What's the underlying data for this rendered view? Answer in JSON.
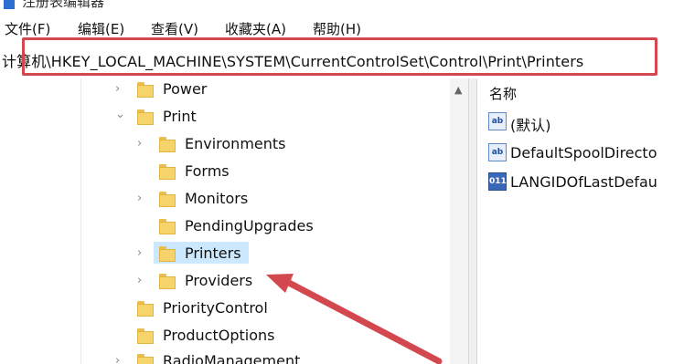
{
  "window": {
    "title": "注册表编辑器"
  },
  "menu": [
    {
      "label": "文件(F)"
    },
    {
      "label": "编辑(E)"
    },
    {
      "label": "查看(V)"
    },
    {
      "label": "收藏夹(A)"
    },
    {
      "label": "帮助(H)"
    }
  ],
  "address": {
    "path": "计算机\\HKEY_LOCAL_MACHINE\\SYSTEM\\CurrentControlSet\\Control\\Print\\Printers"
  },
  "tree": {
    "nodes": [
      {
        "label": "Power",
        "state": "collapsed"
      },
      {
        "label": "Print",
        "state": "expanded"
      },
      {
        "label": "Environments",
        "state": "collapsed"
      },
      {
        "label": "Forms",
        "state": "none"
      },
      {
        "label": "Monitors",
        "state": "collapsed"
      },
      {
        "label": "PendingUpgrades",
        "state": "none"
      },
      {
        "label": "Printers",
        "state": "collapsed",
        "selected": true
      },
      {
        "label": "Providers",
        "state": "collapsed"
      },
      {
        "label": "PriorityControl",
        "state": "none"
      },
      {
        "label": "ProductOptions",
        "state": "none"
      },
      {
        "label": "RadioManagement",
        "state": "collapsed"
      }
    ]
  },
  "values": {
    "header": "名称",
    "items": [
      {
        "name": "(默认)",
        "icon": "ab"
      },
      {
        "name": "DefaultSpoolDirecto",
        "icon": "ab"
      },
      {
        "name": "LANGIDOfLastDefau",
        "icon": "binary"
      }
    ]
  },
  "colors": {
    "highlight_box": "#d3474f",
    "selection": "#cce8ff",
    "arrow": "#d3474f"
  }
}
